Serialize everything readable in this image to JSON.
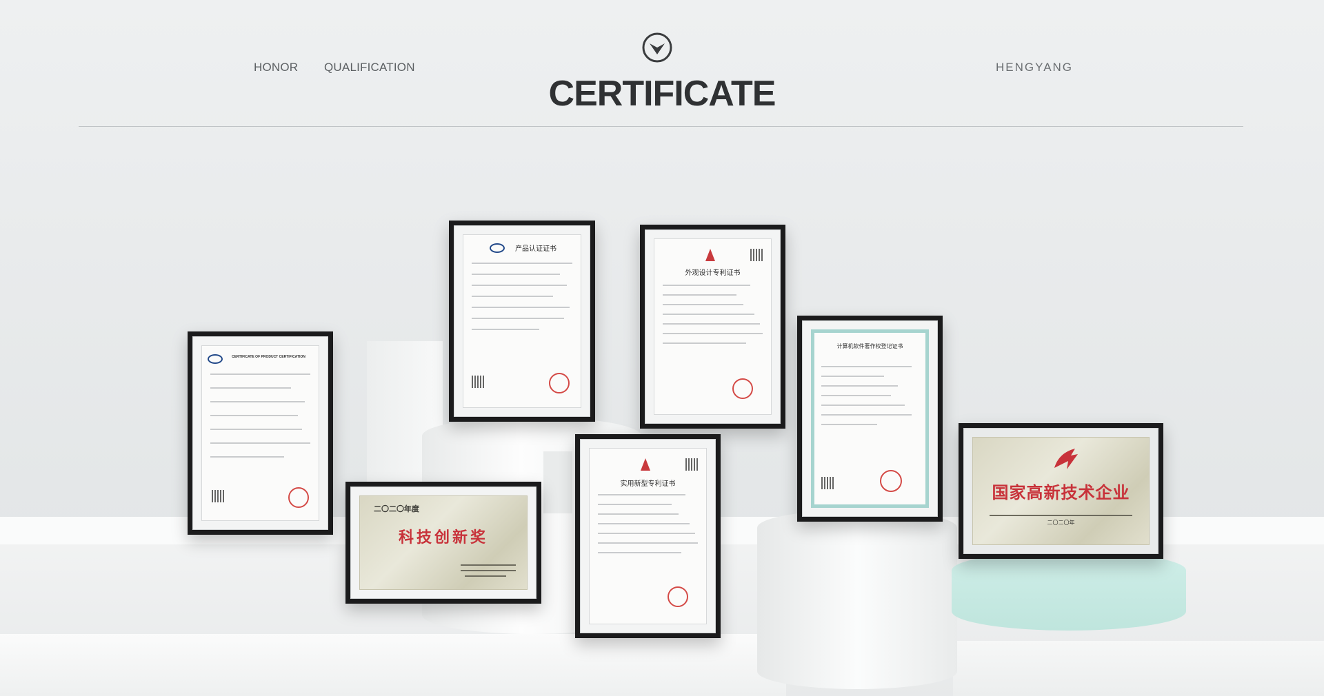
{
  "header": {
    "nav": [
      "HONOR",
      "QUALIFICATION"
    ],
    "title": "CERTIFICATE",
    "brand": "HENGYANG"
  },
  "certificates": [
    {
      "name": "cert-product-certification-en",
      "title": "CERTIFICATE OF PRODUCT CERTIFICATION"
    },
    {
      "name": "cert-product-certification-cn",
      "title": "产品认证证书"
    },
    {
      "name": "cert-design-patent",
      "title": "外观设计专利证书"
    },
    {
      "name": "cert-software-copyright",
      "title": "计算机软件著作权登记证书"
    },
    {
      "name": "award-tech-innovation",
      "year": "二〇二〇年度",
      "title": "科技创新奖"
    },
    {
      "name": "cert-utility-model-patent",
      "title": "实用新型专利证书"
    },
    {
      "name": "plaque-high-tech-enterprise",
      "title": "国家高新技术企业",
      "year": "二〇二〇年"
    }
  ],
  "colors": {
    "title": "#2f3133",
    "nav": "#5b5f62",
    "frame": "#1b1b1c",
    "seal": "#d44a46",
    "plaque_text": "#c8323a"
  },
  "icons": {
    "logo": "circle-chevron-down-icon"
  }
}
